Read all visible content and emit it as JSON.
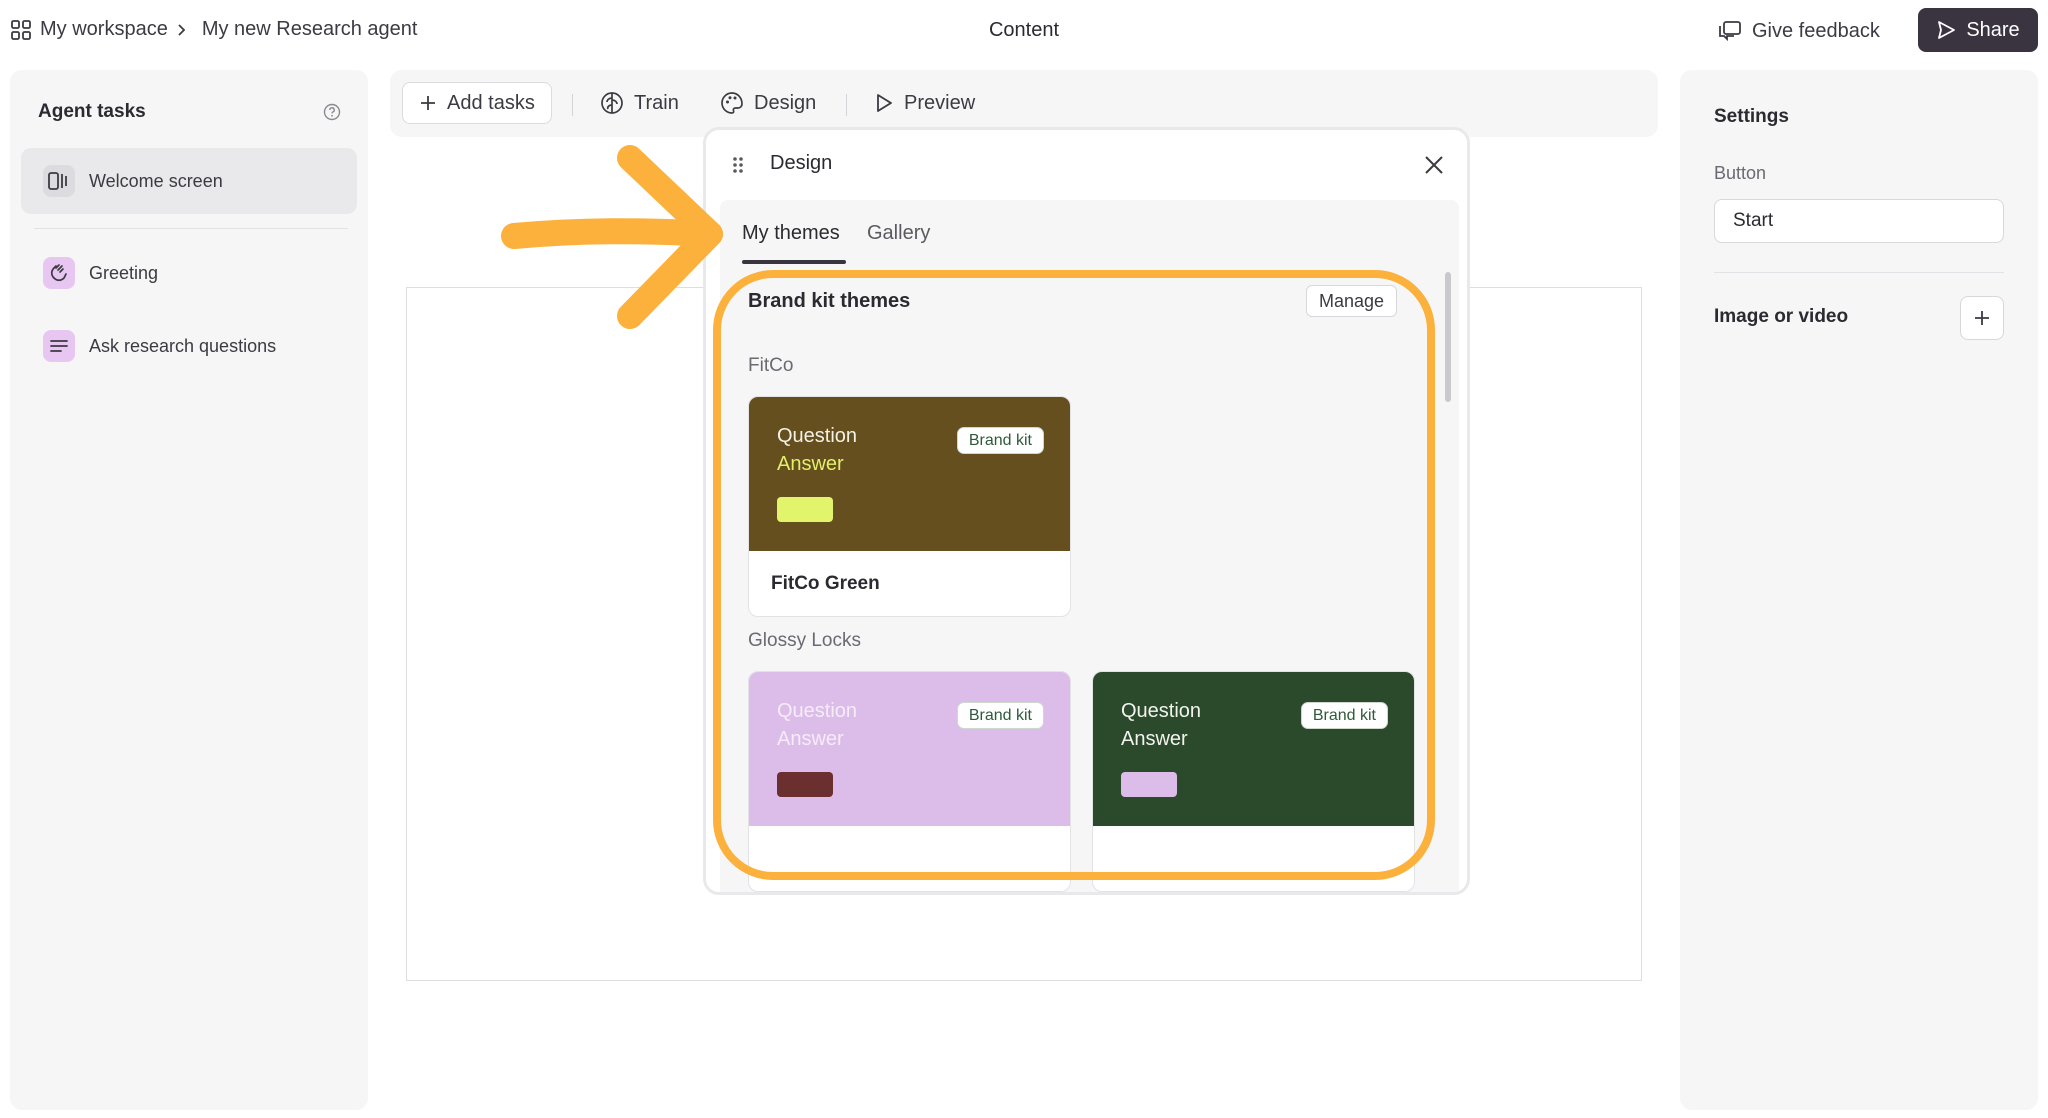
{
  "topbar": {
    "breadcrumb": [
      "My workspace",
      "My new Research agent"
    ],
    "title": "Content",
    "feedback_label": "Give feedback",
    "share_label": "Share"
  },
  "agent_tasks": {
    "title": "Agent tasks",
    "items": [
      {
        "label": "Welcome screen",
        "icon": "welcome-screen-icon",
        "active": true
      },
      {
        "label": "Greeting",
        "icon": "wave-icon",
        "active": false
      },
      {
        "label": "Ask research questions",
        "icon": "list-icon",
        "active": false
      }
    ]
  },
  "toolbar": {
    "add_tasks": "Add tasks",
    "train": "Train",
    "design": "Design",
    "preview": "Preview"
  },
  "design_popup": {
    "title": "Design",
    "tabs": [
      "My themes",
      "Gallery"
    ],
    "active_tab": "My themes",
    "section_title": "Brand kit themes",
    "manage_label": "Manage",
    "groups": [
      {
        "name": "FitCo",
        "themes": [
          {
            "name": "FitCo Green",
            "question": "Question",
            "answer": "Answer",
            "badge": "Brand kit",
            "bg": "#654f1e",
            "q_color": "#f4f1e6",
            "a_color": "#e3f06a",
            "swatch": "#e2f46b"
          }
        ]
      },
      {
        "name": "Glossy Locks",
        "themes": [
          {
            "name": "",
            "question": "Question",
            "answer": "Answer",
            "badge": "Brand kit",
            "bg": "#dcbde9",
            "q_color": "#f5ecf8",
            "a_color": "#f5ecf8",
            "swatch": "#6b2f2f"
          },
          {
            "name": "",
            "question": "Question",
            "answer": "Answer",
            "badge": "Brand kit",
            "bg": "#2b4a2b",
            "q_color": "#f3f3ee",
            "a_color": "#f3f3ee",
            "swatch": "#dcbde9"
          }
        ]
      }
    ]
  },
  "settings": {
    "title": "Settings",
    "button_label": "Button",
    "button_value": "Start",
    "media_label": "Image or video"
  },
  "colors": {
    "highlight": "#fbb13c",
    "share_bg": "#3a3340",
    "panel_bg": "#f6f6f6"
  }
}
